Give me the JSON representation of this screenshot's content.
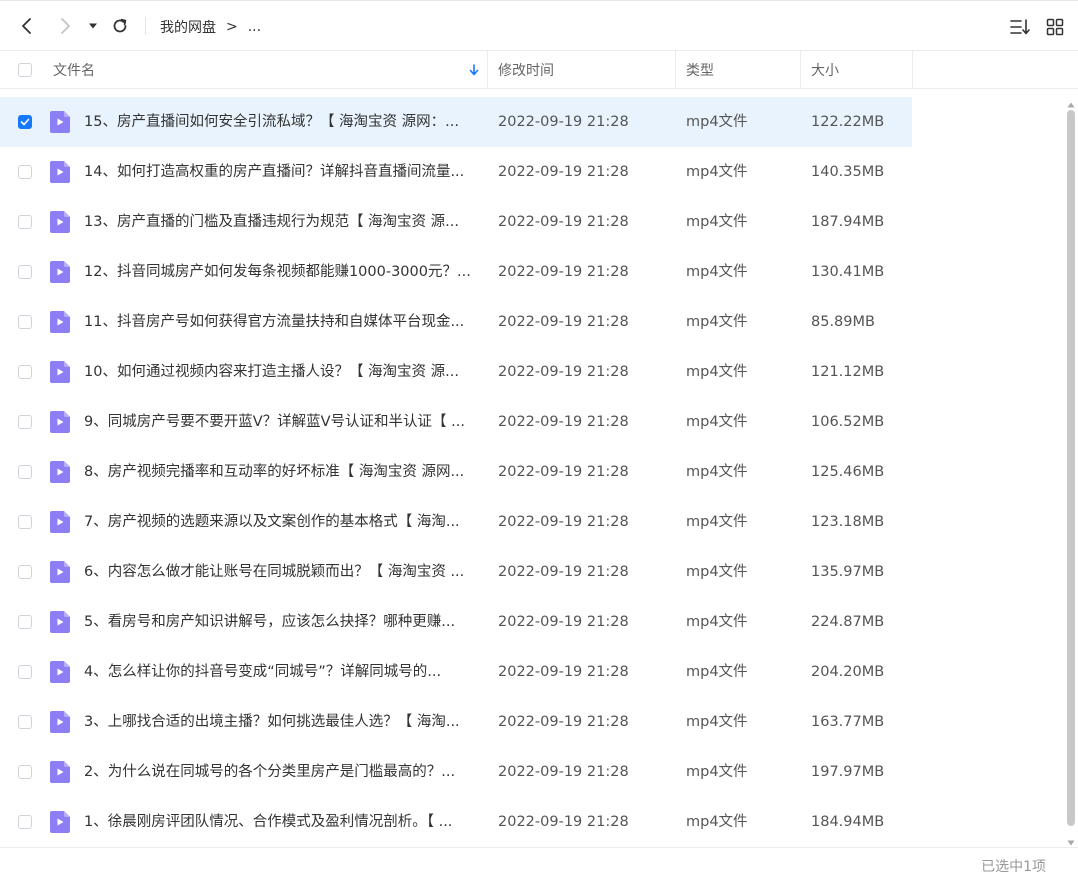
{
  "toolbar": {
    "breadcrumb": [
      "我的网盘",
      ">",
      "..."
    ]
  },
  "columns": {
    "name": "文件名",
    "modified": "修改时间",
    "type": "类型",
    "size": "大小"
  },
  "colors": {
    "accent": "#1677ff",
    "selected_row": "#e8f3fd",
    "file_icon": "#8c7ef5"
  },
  "files": [
    {
      "name": "15、房产直播间如何安全引流私域？【 海淘宝资 源网：...",
      "modified": "2022-09-19 21:28",
      "type": "mp4文件",
      "size": "122.22MB",
      "selected": true
    },
    {
      "name": "14、如何打造高权重的房产直播间？详解抖音直播间流量...",
      "modified": "2022-09-19 21:28",
      "type": "mp4文件",
      "size": "140.35MB",
      "selected": false
    },
    {
      "name": "13、房产直播的门槛及直播违规行为规范【 海淘宝资 源...",
      "modified": "2022-09-19 21:28",
      "type": "mp4文件",
      "size": "187.94MB",
      "selected": false
    },
    {
      "name": "12、抖音同城房产如何发每条视频都能赚1000-3000元？...",
      "modified": "2022-09-19 21:28",
      "type": "mp4文件",
      "size": "130.41MB",
      "selected": false
    },
    {
      "name": "11、抖音房产号如何获得官方流量扶持和自媒体平台现金...",
      "modified": "2022-09-19 21:28",
      "type": "mp4文件",
      "size": "85.89MB",
      "selected": false
    },
    {
      "name": "10、如何通过视频内容来打造主播人设？【 海淘宝资 源...",
      "modified": "2022-09-19 21:28",
      "type": "mp4文件",
      "size": "121.12MB",
      "selected": false
    },
    {
      "name": "9、同城房产号要不要开蓝V？详解蓝V号认证和半认证【 ...",
      "modified": "2022-09-19 21:28",
      "type": "mp4文件",
      "size": "106.52MB",
      "selected": false
    },
    {
      "name": "8、房产视频完播率和互动率的好坏标准【 海淘宝资 源网...",
      "modified": "2022-09-19 21:28",
      "type": "mp4文件",
      "size": "125.46MB",
      "selected": false
    },
    {
      "name": "7、房产视频的选题来源以及文案创作的基本格式【 海淘...",
      "modified": "2022-09-19 21:28",
      "type": "mp4文件",
      "size": "123.18MB",
      "selected": false
    },
    {
      "name": "6、内容怎么做才能让账号在同城脱颖而出？【 海淘宝资 ...",
      "modified": "2022-09-19 21:28",
      "type": "mp4文件",
      "size": "135.97MB",
      "selected": false
    },
    {
      "name": "5、看房号和房产知识讲解号，应该怎么抉择？哪种更赚...",
      "modified": "2022-09-19 21:28",
      "type": "mp4文件",
      "size": "224.87MB",
      "selected": false
    },
    {
      "name": "4、怎么样让你的抖音号变成“同城号”？详解同城号的...",
      "modified": "2022-09-19 21:28",
      "type": "mp4文件",
      "size": "204.20MB",
      "selected": false
    },
    {
      "name": "3、上哪找合适的出境主播？如何挑选最佳人选？【 海淘...",
      "modified": "2022-09-19 21:28",
      "type": "mp4文件",
      "size": "163.77MB",
      "selected": false
    },
    {
      "name": "2、为什么说在同城号的各个分类里房产是门槛最高的？...",
      "modified": "2022-09-19 21:28",
      "type": "mp4文件",
      "size": "197.97MB",
      "selected": false
    },
    {
      "name": "1、徐晨刚房评团队情况、合作模式及盈利情况剖析。【 ...",
      "modified": "2022-09-19 21:28",
      "type": "mp4文件",
      "size": "184.94MB",
      "selected": false
    }
  ],
  "footer": {
    "status": "已选中1项"
  }
}
